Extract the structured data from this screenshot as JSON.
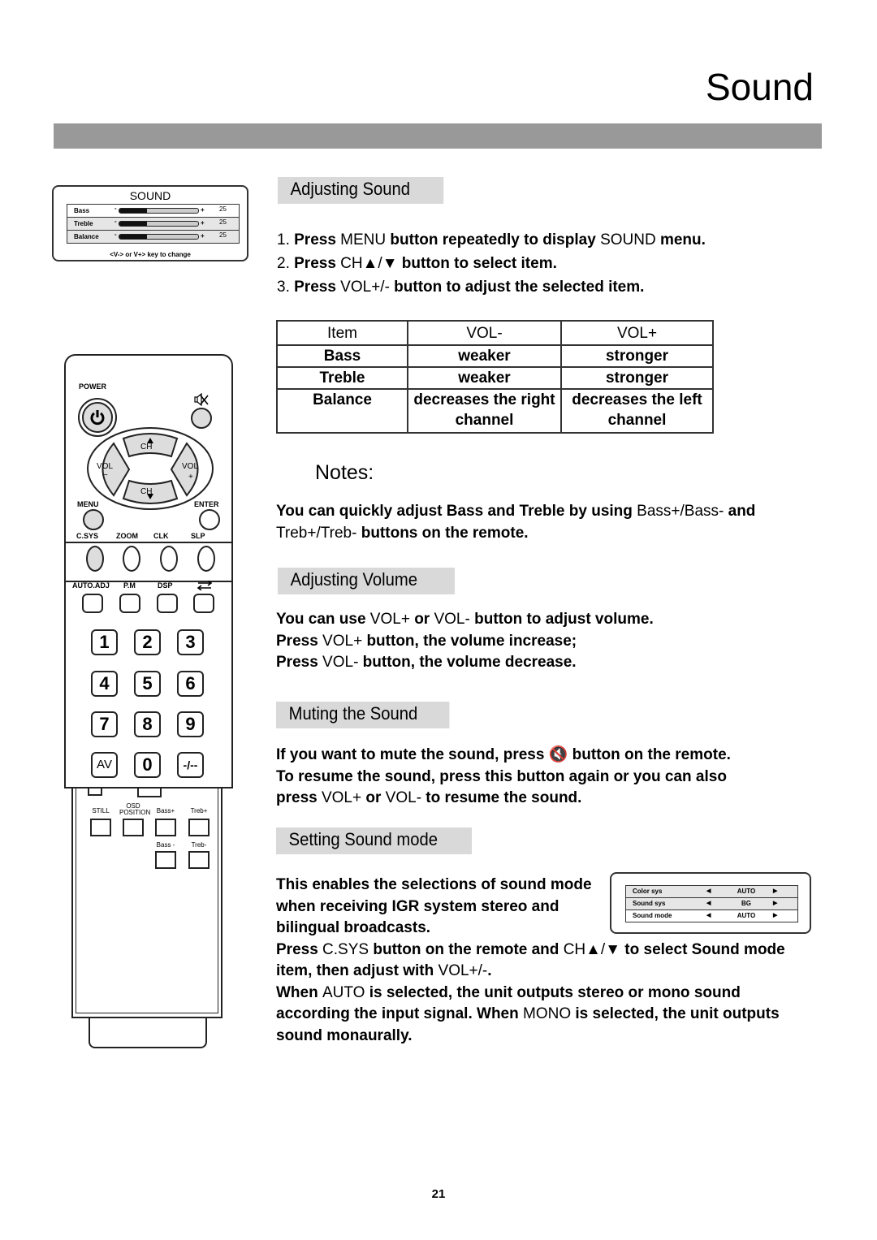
{
  "page": {
    "title": "Sound",
    "page_number": "21"
  },
  "osd_sound": {
    "title": "SOUND",
    "rows": [
      {
        "label": "Bass",
        "minus": "-",
        "plus": "+",
        "value": "25",
        "level_fraction": 0.35
      },
      {
        "label": "Treble",
        "minus": "-",
        "plus": "+",
        "value": "25",
        "level_fraction": 0.35
      },
      {
        "label": "Balance",
        "minus": "-",
        "plus": "+",
        "value": "25",
        "level_fraction": 0.35
      }
    ],
    "hint": "<V-> or V+> key to change"
  },
  "adjusting_sound": {
    "header": "Adjusting Sound",
    "steps": [
      {
        "num": "1.",
        "parts": [
          {
            "t": "Press ",
            "b": true
          },
          {
            "t": "MENU ",
            "b": false
          },
          {
            "t": "button repeatedly to display ",
            "b": true
          },
          {
            "t": "SOUND ",
            "b": false
          },
          {
            "t": "menu.",
            "b": true
          }
        ]
      },
      {
        "num": "2.",
        "parts": [
          {
            "t": "Press ",
            "b": true
          },
          {
            "t": "CH▲/▼ ",
            "b": false
          },
          {
            "t": " button to select item.",
            "b": true
          }
        ]
      },
      {
        "num": "3.",
        "parts": [
          {
            "t": "Press ",
            "b": true
          },
          {
            "t": "VOL+/- ",
            "b": false
          },
          {
            "t": "button to adjust the selected item.",
            "b": true
          }
        ]
      }
    ],
    "table": {
      "headers": [
        "Item",
        "VOL-",
        "VOL+"
      ],
      "rows": [
        [
          "Bass",
          "weaker",
          "stronger"
        ],
        [
          "Treble",
          "weaker",
          "stronger"
        ],
        [
          "Balance",
          "decreases the right channel",
          "decreases the left channel"
        ]
      ]
    }
  },
  "notes": {
    "title": "Notes:",
    "parts": [
      {
        "t": "You can quickly adjust Bass and Treble by using ",
        "b": true
      },
      {
        "t": "Bass+/Bass-",
        "b": false
      },
      {
        "t": " and ",
        "b": true
      },
      {
        "t": "Treb+/Treb-",
        "b": false
      },
      {
        "t": " buttons on the remote.",
        "b": true
      }
    ]
  },
  "adjusting_volume": {
    "header": "Adjusting Volume",
    "lines": [
      [
        {
          "t": "You can use ",
          "b": true
        },
        {
          "t": "VOL+",
          "b": false
        },
        {
          "t": " or ",
          "b": true
        },
        {
          "t": "VOL-",
          "b": false
        },
        {
          "t": " button to adjust volume.",
          "b": true
        }
      ],
      [
        {
          "t": "Press ",
          "b": true
        },
        {
          "t": "VOL+",
          "b": false
        },
        {
          "t": " button, the volume increase;",
          "b": true
        }
      ],
      [
        {
          "t": "Press ",
          "b": true
        },
        {
          "t": "VOL-",
          "b": false
        },
        {
          "t": " button, the volume decrease.",
          "b": true
        }
      ]
    ]
  },
  "muting": {
    "header": "Muting the Sound",
    "lines": [
      [
        {
          "t": "If you want to mute the sound, press ",
          "b": true
        },
        {
          "t": "🔇",
          "b": false,
          "icon": "mute-icon"
        },
        {
          "t": "  button on the remote.",
          "b": true
        }
      ],
      [
        {
          "t": "To resume the sound, press this button again or you can also",
          "b": true
        }
      ],
      [
        {
          "t": "press ",
          "b": true
        },
        {
          "t": "VOL+",
          "b": false
        },
        {
          "t": " or ",
          "b": true
        },
        {
          "t": "VOL-",
          "b": false
        },
        {
          "t": " to resume the sound.",
          "b": true
        }
      ]
    ]
  },
  "sound_mode": {
    "header": "Setting Sound mode",
    "lines": [
      [
        {
          "t": "This enables the selections of sound mode",
          "b": true
        }
      ],
      [
        {
          "t": "when receiving IGR system stereo and",
          "b": true
        }
      ],
      [
        {
          "t": "bilingual broadcasts.",
          "b": true
        }
      ],
      [
        {
          "t": "Press ",
          "b": true
        },
        {
          "t": "C.SYS",
          "b": false
        },
        {
          "t": " button on the remote and ",
          "b": true
        },
        {
          "t": "CH▲/▼",
          "b": false
        },
        {
          "t": "    to select Sound mode",
          "b": true
        }
      ],
      [
        {
          "t": "item, then adjust with ",
          "b": true
        },
        {
          "t": "VOL+/-",
          "b": false
        },
        {
          "t": ".",
          "b": true
        }
      ],
      [
        {
          "t": "When ",
          "b": true
        },
        {
          "t": "AUTO",
          "b": false
        },
        {
          "t": " is selected, the unit outputs stereo or mono sound",
          "b": true
        }
      ],
      [
        {
          "t": "according the input signal. When ",
          "b": true
        },
        {
          "t": "MONO",
          "b": false
        },
        {
          "t": " is selected, the unit outputs",
          "b": true
        }
      ],
      [
        {
          "t": "sound monaurally.",
          "b": true
        }
      ]
    ],
    "osd": {
      "rows": [
        {
          "label": "Color sys",
          "left": "◀",
          "value": "AUTO",
          "right": "▶"
        },
        {
          "label": "Sound sys",
          "left": "◀",
          "value": "BG",
          "right": "▶"
        },
        {
          "label": "Sound mode",
          "left": "◀",
          "value": "AUTO",
          "right": "▶"
        }
      ]
    }
  },
  "remote": {
    "power": "POWER",
    "ch_up": "CH",
    "ch_down": "CH",
    "vol_minus": "VOL",
    "vol_minus_sign": "−",
    "vol_plus": "VOL",
    "vol_plus_sign": "+",
    "menu": "MENU",
    "enter": "ENTER",
    "row1_labels": [
      "C.SYS",
      "ZOOM",
      "CLK",
      "SLP"
    ],
    "row2_labels": [
      "AUTO.ADJ",
      "P.M",
      "DSP"
    ],
    "numbers": [
      "1",
      "2",
      "3",
      "4",
      "5",
      "6",
      "7",
      "8",
      "9",
      "AV",
      "0",
      "-/--"
    ],
    "lower_labels": [
      "STILL",
      "OSD POSITION",
      "Bass+",
      "Treb+"
    ],
    "lower_labels2": [
      "Bass -",
      "Treb-"
    ]
  }
}
